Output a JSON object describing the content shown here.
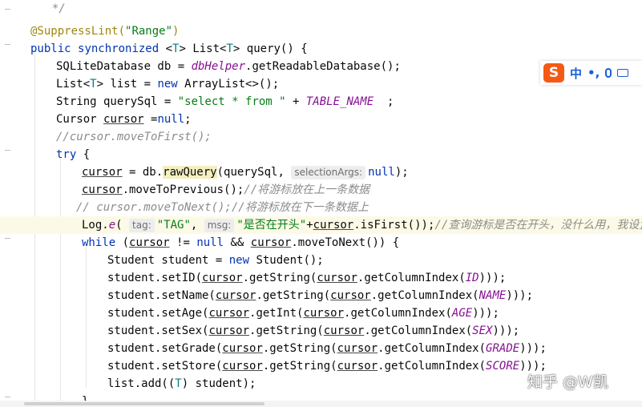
{
  "editor": {
    "lines": [
      [
        {
          "t": "  */",
          "c": "cm"
        }
      ],
      [
        {
          "t": "@SuppressLint(",
          "c": "ann"
        },
        {
          "t": "\"Range\"",
          "c": "str"
        },
        {
          "t": ")",
          "c": "ann"
        }
      ],
      [
        {
          "t": "public ",
          "c": "kw"
        },
        {
          "t": "synchronized ",
          "c": "kw"
        },
        {
          "t": "<"
        },
        {
          "t": "T",
          "c": "typ"
        },
        {
          "t": "> List<"
        },
        {
          "t": "T",
          "c": "typ"
        },
        {
          "t": "> query() {"
        }
      ],
      [
        {
          "t": "SQLiteDatabase db = "
        },
        {
          "t": "dbHelper",
          "c": "fld"
        },
        {
          "t": ".getReadableDatabase();"
        }
      ],
      [
        {
          "t": "List<"
        },
        {
          "t": "T",
          "c": "typ"
        },
        {
          "t": "> list = "
        },
        {
          "t": "new ",
          "c": "kw"
        },
        {
          "t": "ArrayList<>();"
        }
      ],
      [
        {
          "t": "String querySql = "
        },
        {
          "t": "\"select * from \"",
          "c": "str"
        },
        {
          "t": " + "
        },
        {
          "t": "TABLE_NAME",
          "c": "fld"
        },
        {
          "t": "  ;"
        }
      ],
      [
        {
          "t": "Cursor "
        },
        {
          "t": "cursor",
          "c": "ul"
        },
        {
          "t": " ="
        },
        {
          "t": "null",
          "c": "kw"
        },
        {
          "t": ";"
        }
      ],
      [
        {
          "t": "//cursor.moveToFirst();",
          "c": "cm"
        }
      ],
      [
        {
          "t": "try ",
          "c": "kw"
        },
        {
          "t": "{"
        }
      ],
      [
        {
          "t": "cursor",
          "c": "ul"
        },
        {
          "t": " = db."
        },
        {
          "t": "rawQuery",
          "c": "fnhl"
        },
        {
          "t": "(querySql, "
        },
        {
          "t": "selectionArgs:",
          "c": "hint"
        },
        {
          "t": "null",
          "c": "kw"
        },
        {
          "t": ");"
        }
      ],
      [
        {
          "t": "cursor",
          "c": "ul"
        },
        {
          "t": ".moveToPrevious();"
        },
        {
          "t": "//将游标放在上一条数据",
          "c": "cm"
        }
      ],
      [
        {
          "t": "// cursor.moveToNext();//将游标放在下一条数据上",
          "c": "cm"
        }
      ],
      [
        {
          "t": "Log."
        },
        {
          "t": "e",
          "c": "fld"
        },
        {
          "t": "( "
        },
        {
          "t": "tag:",
          "c": "hint"
        },
        {
          "t": "\"TAG\"",
          "c": "str"
        },
        {
          "t": ", "
        },
        {
          "t": "msg:",
          "c": "hint"
        },
        {
          "t": "\"是否在开头\"",
          "c": "str"
        },
        {
          "t": "+"
        },
        {
          "t": "cursor",
          "c": "ul"
        },
        {
          "t": ".isFirst());"
        },
        {
          "t": "//查询游标是否在开头，没什么用，我设置了的",
          "c": "cm"
        }
      ],
      [
        {
          "t": "while ",
          "c": "kw"
        },
        {
          "t": "("
        },
        {
          "t": "cursor",
          "c": "ul"
        },
        {
          "t": " != "
        },
        {
          "t": "null ",
          "c": "kw"
        },
        {
          "t": "&& "
        },
        {
          "t": "cursor",
          "c": "ul"
        },
        {
          "t": ".moveToNext()) {"
        }
      ],
      [
        {
          "t": "Student student = "
        },
        {
          "t": "new ",
          "c": "kw"
        },
        {
          "t": "Student();"
        }
      ],
      [
        {
          "t": "student.setID("
        },
        {
          "t": "cursor",
          "c": "ul"
        },
        {
          "t": ".getString("
        },
        {
          "t": "cursor",
          "c": "ul"
        },
        {
          "t": ".getColumnIndex("
        },
        {
          "t": "ID",
          "c": "fld"
        },
        {
          "t": ")));"
        }
      ],
      [
        {
          "t": "student.setName("
        },
        {
          "t": "cursor",
          "c": "ul"
        },
        {
          "t": ".getString("
        },
        {
          "t": "cursor",
          "c": "ul"
        },
        {
          "t": ".getColumnIndex("
        },
        {
          "t": "NAME",
          "c": "fld"
        },
        {
          "t": ")));"
        }
      ],
      [
        {
          "t": "student.setAge("
        },
        {
          "t": "cursor",
          "c": "ul"
        },
        {
          "t": ".getInt("
        },
        {
          "t": "cursor",
          "c": "ul"
        },
        {
          "t": ".getColumnIndex("
        },
        {
          "t": "AGE",
          "c": "fld"
        },
        {
          "t": ")));"
        }
      ],
      [
        {
          "t": "student.setSex("
        },
        {
          "t": "cursor",
          "c": "ul"
        },
        {
          "t": ".getString("
        },
        {
          "t": "cursor",
          "c": "ul"
        },
        {
          "t": ".getColumnIndex("
        },
        {
          "t": "SEX",
          "c": "fld"
        },
        {
          "t": ")));"
        }
      ],
      [
        {
          "t": "student.setGrade("
        },
        {
          "t": "cursor",
          "c": "ul"
        },
        {
          "t": ".getString("
        },
        {
          "t": "cursor",
          "c": "ul"
        },
        {
          "t": ".getColumnIndex("
        },
        {
          "t": "GRADE",
          "c": "fld"
        },
        {
          "t": ")));"
        }
      ],
      [
        {
          "t": "student.setStore("
        },
        {
          "t": "cursor",
          "c": "ul"
        },
        {
          "t": ".getString("
        },
        {
          "t": "cursor",
          "c": "ul"
        },
        {
          "t": ".getColumnIndex("
        },
        {
          "t": "SCORE",
          "c": "fld"
        },
        {
          "t": ")));"
        }
      ],
      [
        {
          "t": "list.add(("
        },
        {
          "t": "T",
          "c": "typ"
        },
        {
          "t": ") student);"
        }
      ],
      [
        {
          "t": "}"
        }
      ]
    ]
  },
  "ime": {
    "logo": "S",
    "mode": "中",
    "punct": "•,",
    "mic_icon": "mic-icon",
    "keyboard_icon": "keyboard-icon"
  },
  "watermark": "知乎 @W凯",
  "colors": {
    "keyword": "#0033b3",
    "annotation": "#9e880d",
    "string": "#067d17",
    "comment": "#8c8c8c",
    "field": "#871094",
    "current_line": "#fcfae6",
    "ime_logo": "#f55a14"
  }
}
